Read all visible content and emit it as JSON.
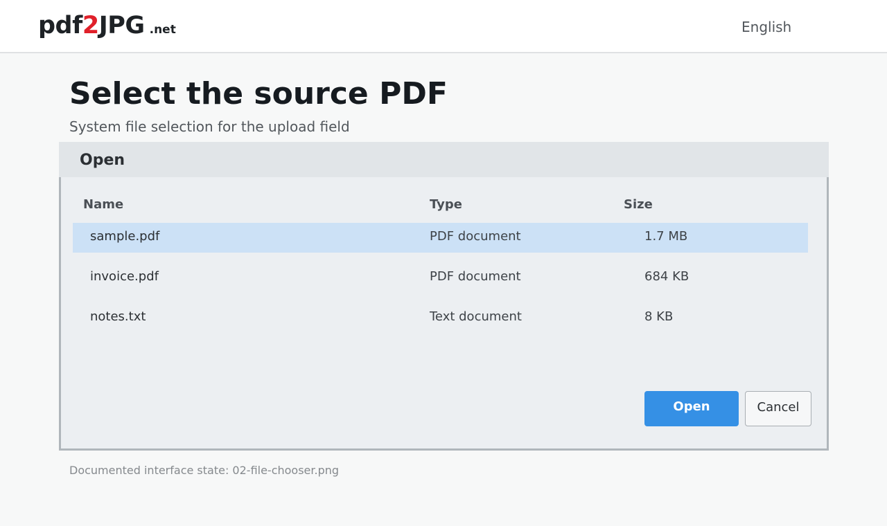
{
  "header": {
    "logo": {
      "part1": "pdf",
      "part2": "2",
      "part3": "JPG",
      "tld": ".net"
    },
    "language": "English"
  },
  "page": {
    "title": "Select the source PDF",
    "subtitle": "System file selection for the upload field"
  },
  "dialog": {
    "title": "Open",
    "columns": {
      "name": "Name",
      "type": "Type",
      "size": "Size"
    },
    "files": [
      {
        "name": "sample.pdf",
        "type": "PDF document",
        "size": "1.7 MB",
        "selected": true
      },
      {
        "name": "invoice.pdf",
        "type": "PDF document",
        "size": "684 KB",
        "selected": false
      },
      {
        "name": "notes.txt",
        "type": "Text document",
        "size": "8 KB",
        "selected": false
      }
    ],
    "open_button": "Open",
    "cancel_button": "Cancel"
  },
  "footnote": "Documented interface state: 02-file-chooser.png",
  "colors": {
    "accent": "#3590e5",
    "logo_accent": "#e0202a",
    "selection": "#cce1f6"
  }
}
